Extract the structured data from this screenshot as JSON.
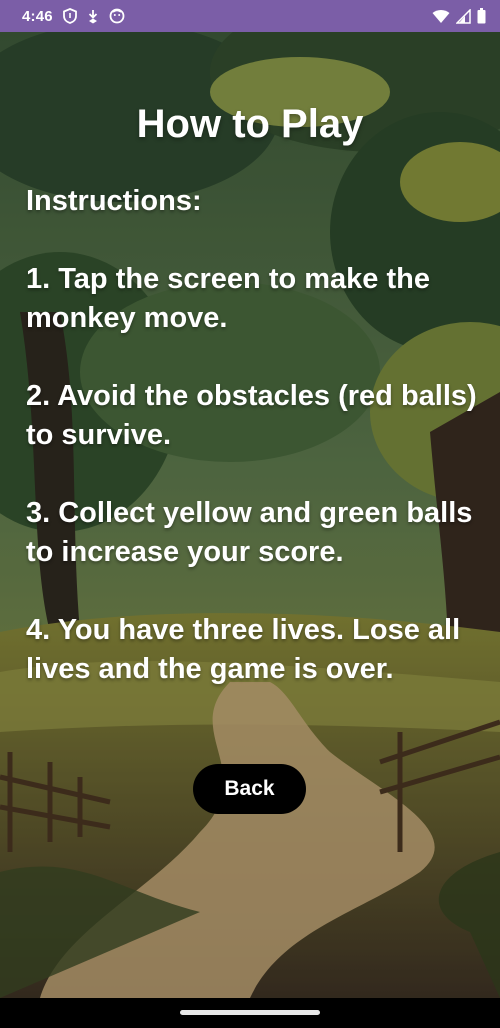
{
  "status_bar": {
    "time": "4:46",
    "left_icons": [
      "shield-icon",
      "download-arrow-icon",
      "face-icon"
    ],
    "right_icons": [
      "wifi-icon",
      "cellular-signal-icon",
      "battery-icon"
    ]
  },
  "screen": {
    "title": "How to Play",
    "instructions_heading": "Instructions:",
    "instructions": [
      "1. Tap the screen to make the monkey move.",
      "2. Avoid the obstacles (red balls) to survive.",
      "3. Collect yellow and green balls to increase your score.",
      "4. You have three lives. Lose all lives and the game is over."
    ],
    "back_label": "Back"
  },
  "colors": {
    "status_bar": "#7b5ea7",
    "button_bg": "#000000",
    "text": "#ffffff"
  }
}
